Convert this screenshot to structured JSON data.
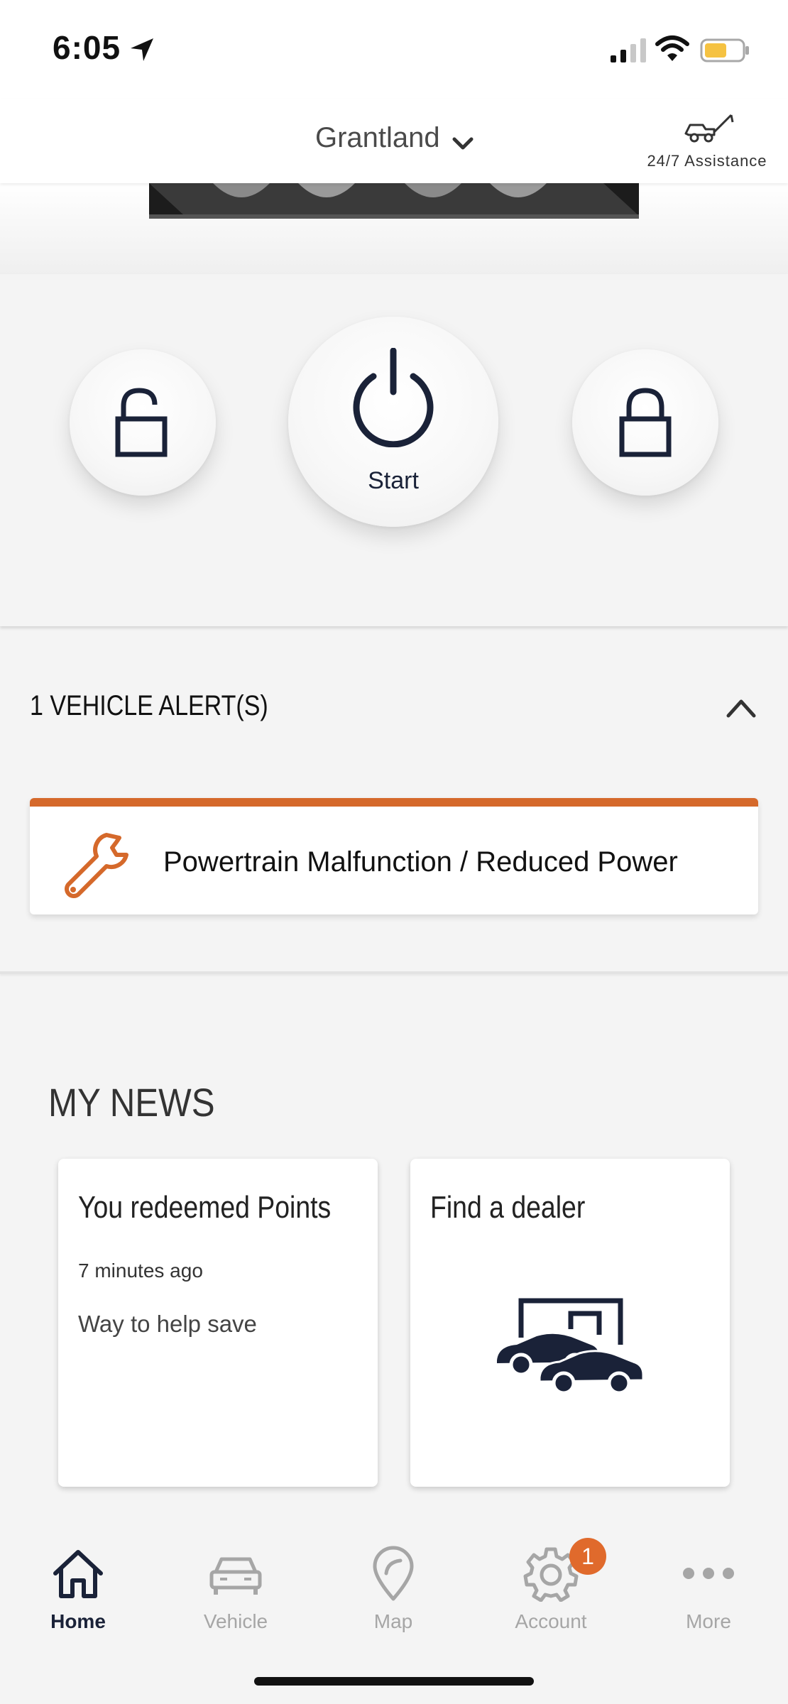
{
  "status_bar": {
    "time": "6:05"
  },
  "header": {
    "vehicle_name": "Grantland",
    "assistance_label": "24/7 Assistance"
  },
  "controls": {
    "start_label": "Start"
  },
  "alerts": {
    "title": "1 VEHICLE ALERT(S)",
    "items": [
      {
        "text": "Powertrain Malfunction / Reduced Power",
        "accent_color": "#d5692b",
        "icon": "wrench-icon"
      }
    ]
  },
  "news": {
    "title": "MY NEWS",
    "cards": [
      {
        "title": "You redeemed Points",
        "time": "7 minutes ago",
        "body": "Way to help save"
      },
      {
        "title": "Find a dealer",
        "icon": "dealer-icon"
      }
    ]
  },
  "nav": {
    "items": [
      {
        "label": "Home",
        "icon": "home-icon",
        "active": true
      },
      {
        "label": "Vehicle",
        "icon": "car-icon"
      },
      {
        "label": "Map",
        "icon": "map-pin-icon"
      },
      {
        "label": "Account",
        "icon": "gear-icon",
        "badge": "1"
      },
      {
        "label": "More",
        "icon": "more-icon"
      }
    ]
  },
  "colors": {
    "brand_navy": "#1a2238",
    "alert_orange": "#d5692b"
  }
}
